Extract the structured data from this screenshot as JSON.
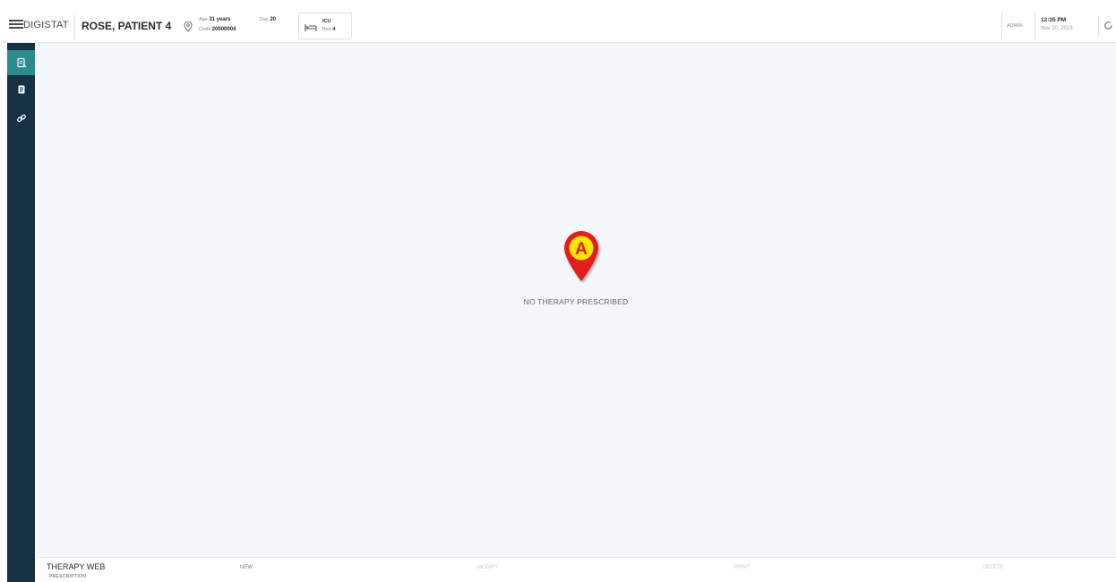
{
  "header": {
    "app_title": "DIGISTAT",
    "patient_name": "ROSE, PATIENT 4",
    "age_label": "Age",
    "age_value": "31 years",
    "day_label": "Day",
    "day_value": "20",
    "code_label": "Code",
    "code_value": "20000004",
    "ward_value": "ICU",
    "bed_label": "Bed",
    "bed_value": "4",
    "user": "ADMIN",
    "time": "12:35 PM",
    "date": "Nov 10, 2023"
  },
  "sidebar": {
    "items": [
      {
        "icon": "prescription-icon",
        "active": true
      },
      {
        "icon": "document-icon",
        "active": false
      },
      {
        "icon": "link-icon",
        "active": false
      }
    ]
  },
  "main": {
    "empty_message": "NO THERAPY PRESCRIBED",
    "marker_label": "A",
    "marker_color": "#e31b1b",
    "marker_fill": "#ffe600"
  },
  "footer": {
    "module_title": "THERAPY WEB",
    "module_subtitle": "PRESCRIPTION",
    "buttons": [
      "NEW",
      "MODIFY",
      "PRINT",
      "DELETE"
    ]
  },
  "colors": {
    "sidebar": "#143243",
    "active_item": "#2a8c8c",
    "background": "#f4f7fb"
  }
}
